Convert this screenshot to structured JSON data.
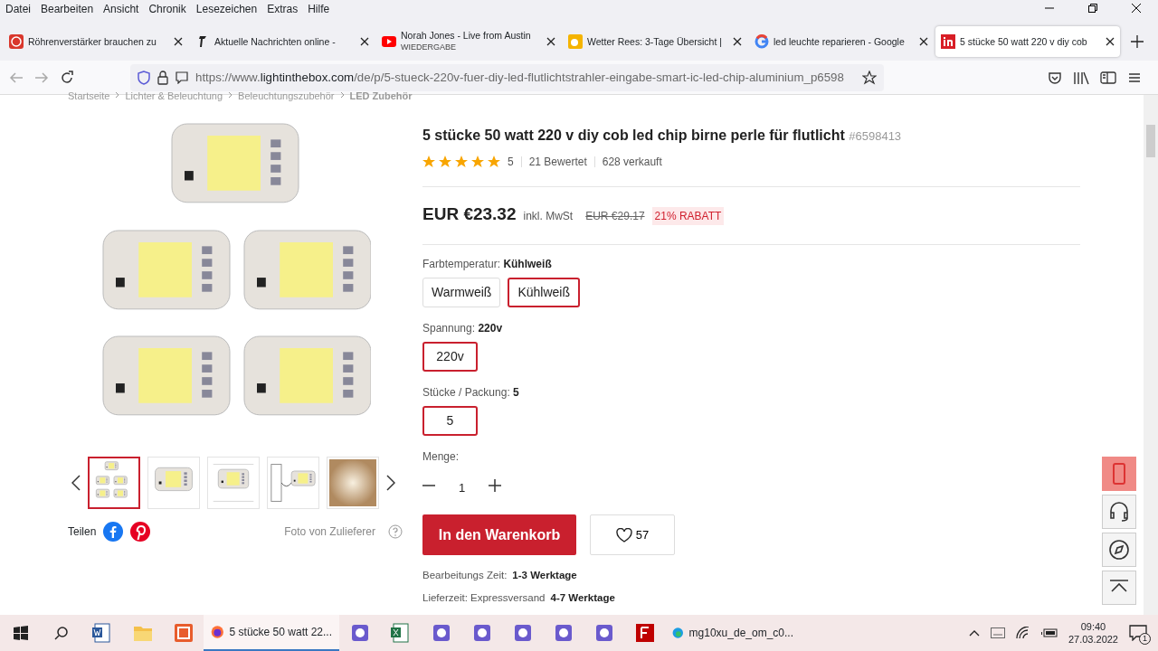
{
  "menu_bar": [
    "Datei",
    "Bearbeiten",
    "Ansicht",
    "Chronik",
    "Lesezeichen",
    "Extras",
    "Hilfe"
  ],
  "tabs": [
    {
      "kind": "red",
      "title": "Röhrenverstärker brauchen zu",
      "selected": false
    },
    {
      "kind": "faz",
      "title": "Aktuelle Nachrichten online -",
      "selected": false
    },
    {
      "kind": "youtube",
      "title": "Norah Jones - Live from Austin",
      "subtitle": "WIEDERGABE",
      "selected": false
    },
    {
      "kind": "weather",
      "title": "Wetter Rees: 3-Tage Übersicht |",
      "selected": false
    },
    {
      "kind": "google",
      "title": "led leuchte reparieren - Google",
      "selected": false
    },
    {
      "kind": "litb",
      "title": "5 stücke 50 watt 220 v diy cob",
      "selected": true
    }
  ],
  "address_bar": {
    "scheme": "https://www.",
    "domain": "lightinthebox.com",
    "path": "/de/p/5-stueck-220v-fuer-diy-led-flutlichtstrahler-eingabe-smart-ic-led-chip-aluminium_p6598"
  },
  "breadcrumb": [
    "Startseite",
    "Lichter & Beleuchtung",
    "Beleuchtungszubehör",
    "LED Zubehör"
  ],
  "gallery": {
    "thumbnails": [
      {
        "kind": "group",
        "selected": true
      },
      {
        "kind": "chip",
        "selected": false
      },
      {
        "kind": "diagram",
        "selected": false
      },
      {
        "kind": "wired",
        "selected": false
      },
      {
        "kind": "light",
        "selected": false
      }
    ],
    "share_label": "Teilen",
    "photo_note": "Foto von Zulieferer"
  },
  "product": {
    "title": "5 stücke 50 watt 220 v diy cob led chip birne perle für flutlicht",
    "sku": "#6598413",
    "stars": 5,
    "rating": "5",
    "reviews": "21 Bewertet",
    "sold": "628 verkauft",
    "price": "EUR €23.32",
    "tax_note": "inkl. MwSt",
    "old_price": "EUR €29.17",
    "discount": "21% RABATT",
    "options": [
      {
        "label": "Farbtemperatur:",
        "value": "Kühlweiß",
        "choices": [
          {
            "label": "Warmweiß",
            "selected": false
          },
          {
            "label": "Kühlweiß",
            "selected": true
          }
        ]
      },
      {
        "label": "Spannung:",
        "value": "220v",
        "choices": [
          {
            "label": "220v",
            "selected": true
          }
        ]
      },
      {
        "label": "Stücke / Packung:",
        "value": "5",
        "choices": [
          {
            "label": "5",
            "selected": true
          }
        ]
      }
    ],
    "quantity": {
      "label": "Menge:",
      "value": "1"
    },
    "cart_button": "In den Warenkorb",
    "wishlist_count": "57",
    "shipping": [
      {
        "label": "Bearbeitungs Zeit:",
        "value": "1-3 Werktage"
      },
      {
        "label": "Lieferzeit: Expressversand",
        "value": "4-7 Werktage"
      }
    ]
  },
  "taskbar": {
    "apps": [
      {
        "kind": "word",
        "active": false
      },
      {
        "kind": "folder",
        "active": false
      },
      {
        "kind": "ec",
        "active": false
      },
      {
        "kind": "firefox",
        "label": "5 stücke 50 watt 22...",
        "active": true
      },
      {
        "kind": "app",
        "active": false
      },
      {
        "kind": "excel",
        "active": false
      },
      {
        "kind": "app",
        "active": false
      },
      {
        "kind": "app",
        "active": false
      },
      {
        "kind": "app",
        "active": false
      },
      {
        "kind": "app",
        "active": false
      },
      {
        "kind": "app",
        "active": false
      },
      {
        "kind": "filezilla",
        "active": false
      },
      {
        "kind": "edge",
        "label": "mg10xu_de_om_c0...",
        "active": false
      }
    ],
    "time": "09:40",
    "date": "27.03.2022",
    "notifications": "1"
  }
}
